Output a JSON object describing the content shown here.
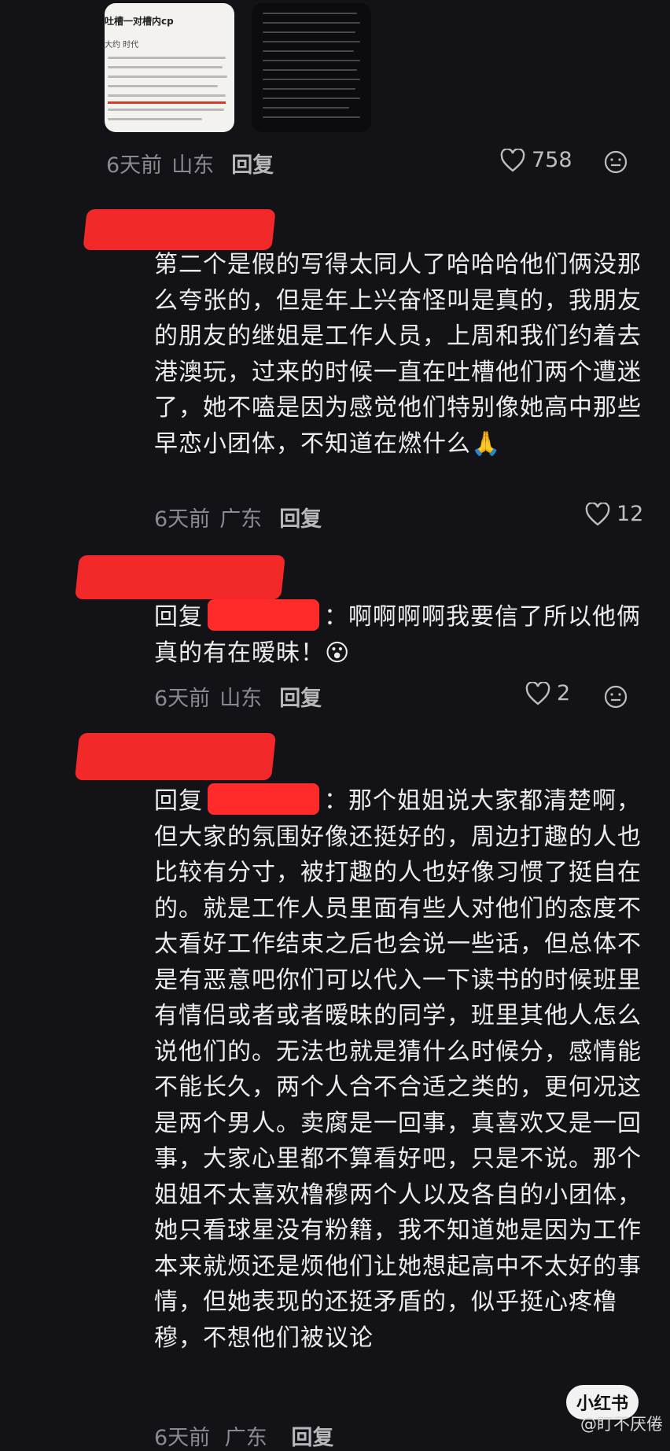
{
  "thumb1": {
    "title": "吐槽一对槽内cp",
    "subtitle": "大约  时代"
  },
  "comments": [
    {
      "time": "6天前",
      "location": "山东",
      "reply": "回复",
      "likes": "758"
    },
    {
      "body": "第二个是假的写得太同人了哈哈哈他们俩没那么夸张的，但是年上兴奋怪叫是真的，我朋友的朋友的继姐是工作人员，上周和我们约着去港澳玩，过来的时候一直在吐槽他们两个遭迷了，她不嗑是因为感觉他们特别像她高中那些早恋小团体，不知道在燃什么🙏",
      "time": "6天前",
      "location": "广东",
      "reply": "回复",
      "likes": "12"
    },
    {
      "reply_prefix": "回复",
      "body": "：啊啊啊啊我要信了所以他俩真的有在暧昧！😮",
      "time": "6天前",
      "location": "山东",
      "reply": "回复",
      "likes": "2"
    },
    {
      "reply_prefix": "回复",
      "body": "：那个姐姐说大家都清楚啊，但大家的氛围好像还挺好的，周边打趣的人也比较有分寸，被打趣的人也好像习惯了挺自在的。就是工作人员里面有些人对他们的态度不太看好工作结束之后也会说一些话，但总体不是有恶意吧你们可以代入一下读书的时候班里有情侣或者或者暧昧的同学，班里其他人怎么说他们的。无法也就是猜什么时候分，感情能不能长久，两个人合不合适之类的，更何况这是两个男人。卖腐是一回事，真喜欢又是一回事，大家心里都不算看好吧，只是不说。那个姐姐不太喜欢橹穆两个人以及各自的小团体，她只看球星没有粉籍，我不知道她是因为工作本来就烦还是烦他们让她想起高中不太好的事情，但她表现的还挺矛盾的，似乎挺心疼橹穆，不想他们被议论",
      "time": "6天前",
      "location": "广东",
      "reply": "回复"
    }
  ],
  "watermark": {
    "app": "小红书",
    "weibo": "@盯不厌倦"
  }
}
